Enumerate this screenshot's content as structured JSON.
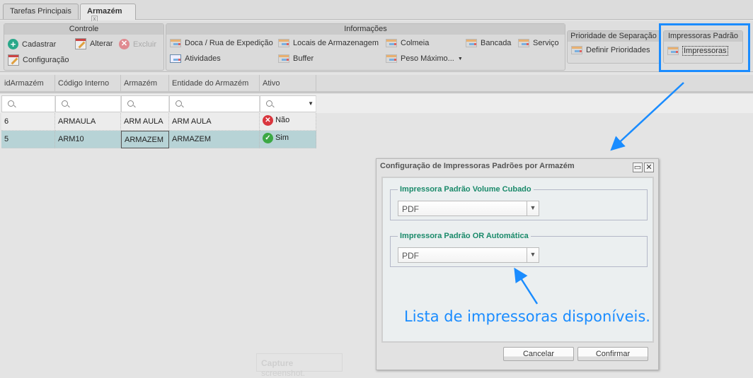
{
  "tabs": [
    {
      "label": "Tarefas Principais"
    },
    {
      "label": "Armazém",
      "close": "x"
    }
  ],
  "toolbar": {
    "controle": {
      "title": "Controle",
      "cadastrar": "Cadastrar",
      "alterar": "Alterar",
      "excluir": "Excluir",
      "configuracao": "Configuração"
    },
    "informacoes": {
      "title": "Informações",
      "doca": "Doca / Rua de Expedição",
      "locais": "Locais de Armazenagem",
      "colmeia": "Colmeia",
      "bancada": "Bancada",
      "servico": "Serviço",
      "atividades": "Atividades",
      "buffer": "Buffer",
      "peso": "Peso Máximo..."
    },
    "prioridade": {
      "title": "Prioridade de Separação",
      "definir": "Definir Prioridades"
    },
    "impressoras": {
      "title": "Impressoras Padrão",
      "impressoras": "Impressoras"
    }
  },
  "grid": {
    "columns": [
      "idArmazém",
      "Código Interno",
      "Armazém",
      "Entidade do Armazém",
      "Ativo"
    ],
    "rows": [
      {
        "id": "6",
        "codigo": "ARMAULA",
        "armazem": "ARM AULA",
        "entidade": "ARM AULA",
        "ativo": "Não"
      },
      {
        "id": "5",
        "codigo": "ARM10",
        "armazem": "ARMAZEM",
        "entidade": "ARMAZEM",
        "ativo": "Sim"
      }
    ]
  },
  "dialog": {
    "title": "Configuração de Impressoras Padrões por Armazém",
    "field1": {
      "label": "Impressora Padrão Volume Cubado",
      "value": "PDF"
    },
    "field2": {
      "label": "Impressora Padrão OR Automática",
      "value": "PDF"
    },
    "cancel": "Cancelar",
    "confirm": "Confirmar"
  },
  "annotation": "Lista de impressoras disponíveis.",
  "watermark": {
    "bold": "Capture",
    "rest": " screenshot."
  },
  "colors": {
    "highlight": "#1a8cff",
    "selected_row": "#b7d3d6",
    "legend": "#1a8a6a"
  }
}
